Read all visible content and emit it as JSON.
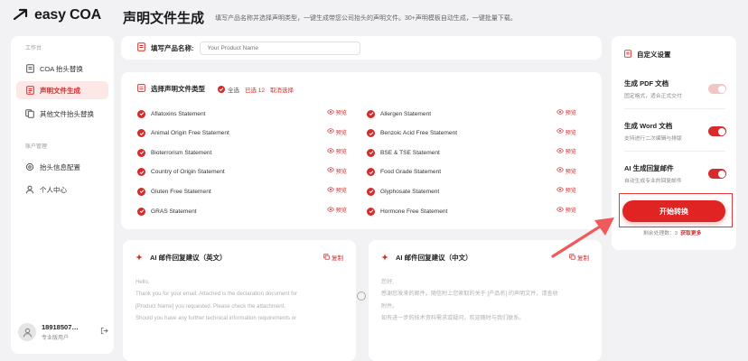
{
  "brand": {
    "logo_text": "easy COA",
    "accent": "#d62b2b"
  },
  "header": {
    "title": "声明文件生成",
    "subtitle": "填写产品名称并选择声明类型，一键生成带您公司抬头的声明文件。30+声明模板自动生成，一键批量下载。"
  },
  "sidebar": {
    "section1": "工作台",
    "items1": [
      {
        "label": "COA 抬头替换",
        "icon": "document-icon"
      },
      {
        "label": "声明文件生成",
        "icon": "declaration-icon",
        "active": true
      },
      {
        "label": "其他文件抬头替换",
        "icon": "file-replace-icon"
      }
    ],
    "section2": "账户管理",
    "items2": [
      {
        "label": "抬头信息配置",
        "icon": "settings-icon"
      },
      {
        "label": "个人中心",
        "icon": "user-icon"
      }
    ],
    "user": {
      "name": "18918507…",
      "role": "专业版用户"
    }
  },
  "product": {
    "label": "填写产品名称:",
    "placeholder": "Your Product Name"
  },
  "types": {
    "title": "选择声明文件类型",
    "select_all": "全选",
    "chosen": "已选 12",
    "cancel": "取消选择",
    "preview_label": "预览",
    "left": [
      "Aflatoxins Statement",
      "Animal Origin Free Statement",
      "Bioterrorism Statement",
      "Country of Origin Statement",
      "Gluten Free Statement",
      "GRAS Statement"
    ],
    "right": [
      "Allergen Statement",
      "Benzoic Acid Free Statement",
      "BSE & TSE Statement",
      "Food Grade Statement",
      "Glyphosate Statement",
      "Hormone Free Statement"
    ]
  },
  "ai_en": {
    "title": "AI 邮件回复建议（英文）",
    "copy": "复制",
    "lines": [
      "",
      "Hello,",
      "Thank you for your email. Attached is the declaration document for",
      "[Product Name] you requested. Please check the attachment.",
      "Should you have any further technical information requirements or"
    ]
  },
  "ai_cn": {
    "title": "AI 邮件回复建议（中文）",
    "copy": "复制",
    "lines": [
      "",
      "您好,",
      "感谢您发来的邮件。随信附上您索取的关于 [产品名] 的声明文件，请查收",
      "附件。",
      "如有进一步的技术资料需求或疑问，欢迎随时与我们联系。"
    ]
  },
  "settings": {
    "title": "自定义设置",
    "rows": [
      {
        "name": "生成 PDF 文档",
        "desc": "固定格式，适合正式交付",
        "on": true,
        "disabled": true
      },
      {
        "name": "生成 Word 文档",
        "desc": "支持进行二次编辑与排版",
        "on": true
      },
      {
        "name": "AI 生成回复邮件",
        "desc": "自动生成专业的回复邮件",
        "on": true
      }
    ],
    "start_button": "开始转换",
    "quota_label": "剩余处理数：3",
    "quota_more": "获取更多"
  }
}
